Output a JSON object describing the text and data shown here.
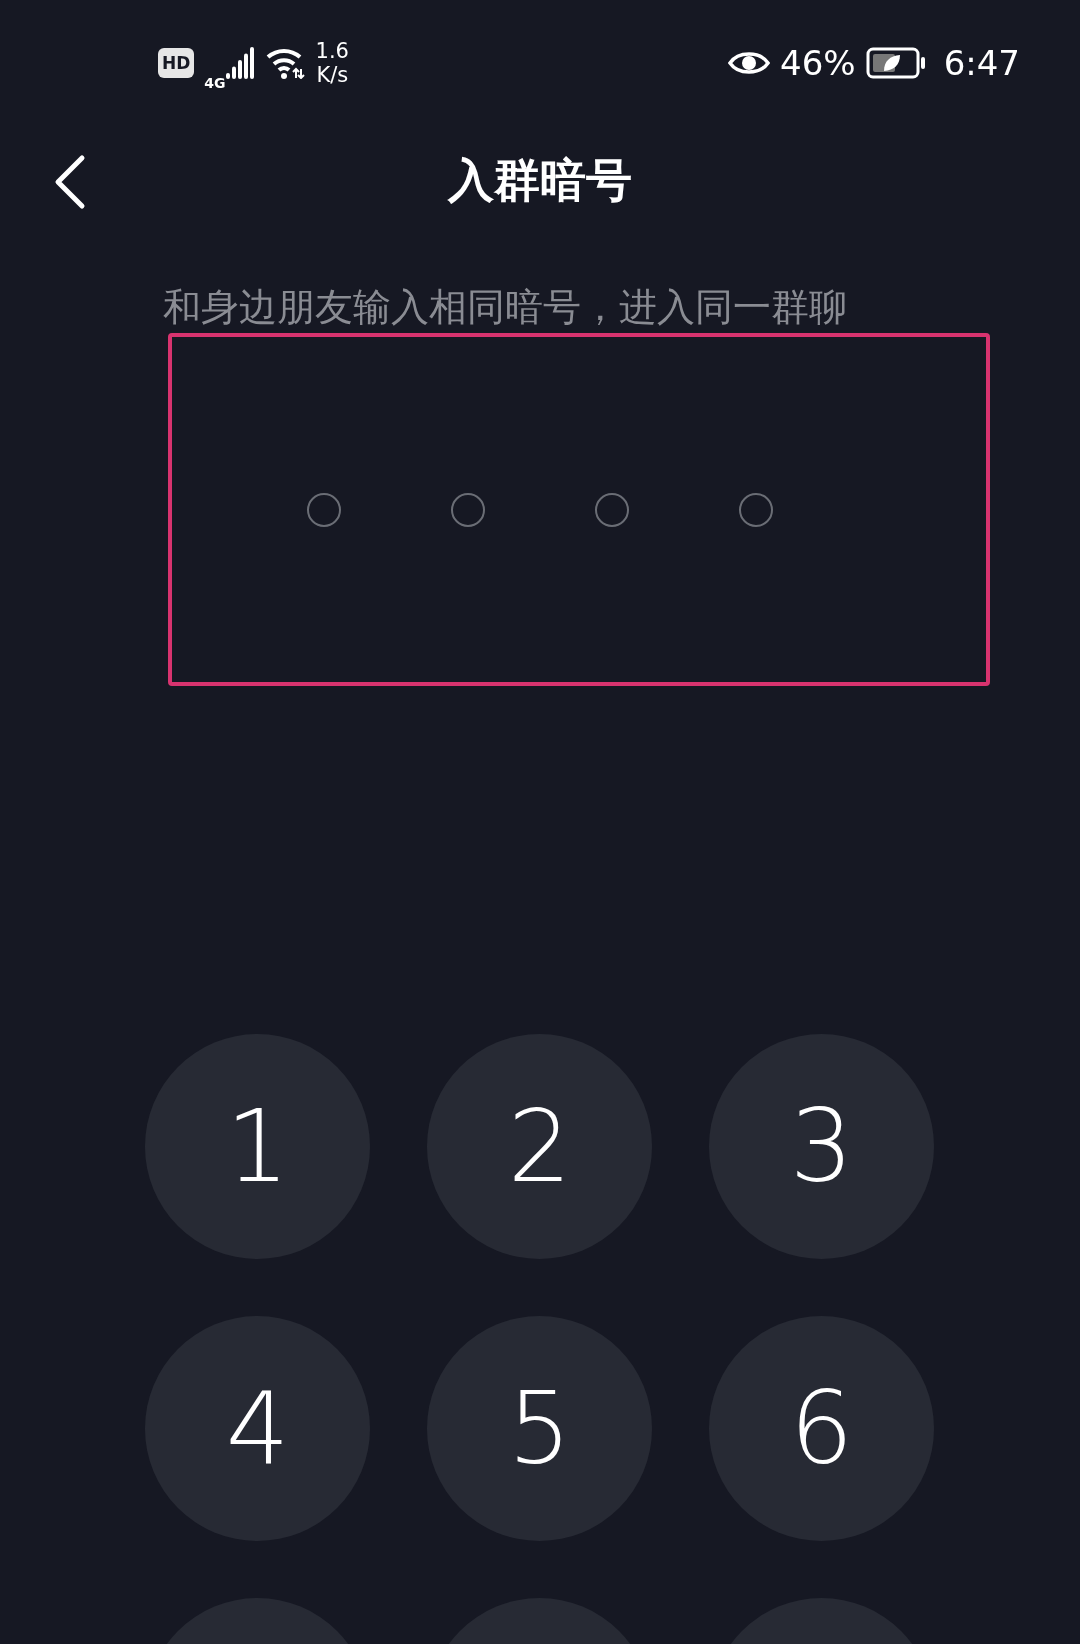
{
  "status_bar": {
    "hd": "HD",
    "network": "4G",
    "speed_value": "1.6",
    "speed_unit": "K/s",
    "battery": "46%",
    "time": "6:47"
  },
  "header": {
    "title": "入群暗号"
  },
  "hint": "和身边朋友输入相同暗号，进入同一群聊",
  "code_slots": [
    {
      "filled": false
    },
    {
      "filled": false
    },
    {
      "filled": false
    },
    {
      "filled": false
    }
  ],
  "keypad": [
    {
      "kind": "digit",
      "label": "1"
    },
    {
      "kind": "digit",
      "label": "2"
    },
    {
      "kind": "digit",
      "label": "3"
    },
    {
      "kind": "digit",
      "label": "4"
    },
    {
      "kind": "digit",
      "label": "5"
    },
    {
      "kind": "digit",
      "label": "6"
    },
    {
      "kind": "blank"
    },
    {
      "kind": "blank"
    },
    {
      "kind": "blank"
    }
  ]
}
